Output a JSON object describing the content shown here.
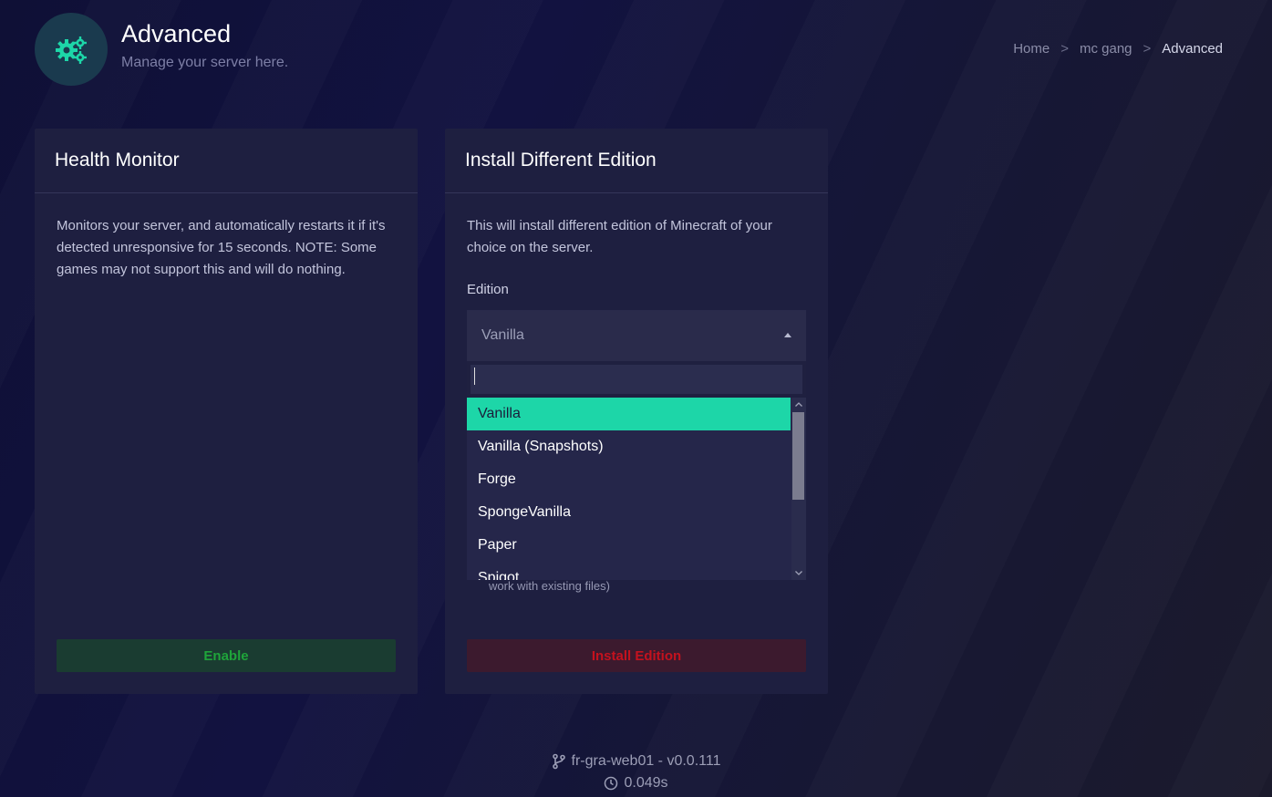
{
  "header": {
    "icon": "gears-icon",
    "title": "Advanced",
    "subtitle": "Manage your server here."
  },
  "breadcrumb": {
    "items": [
      "Home",
      "mc gang",
      "Advanced"
    ],
    "separator": ">"
  },
  "health_monitor": {
    "title": "Health Monitor",
    "description": "Monitors your server, and automatically restarts it if it's detected unresponsive for 15 seconds. NOTE: Some games may not support this and will do nothing.",
    "button_label": "Enable"
  },
  "install_edition": {
    "title": "Install Different Edition",
    "description": "This will install different edition of Minecraft of your choice on the server.",
    "field_label": "Edition",
    "selected_value": "Vanilla",
    "search_value": "",
    "options": [
      "Vanilla",
      "Vanilla (Snapshots)",
      "Forge",
      "SpongeVanilla",
      "Paper",
      "Spigot"
    ],
    "hint": "work with existing files)",
    "button_label": "Install Edition"
  },
  "footer": {
    "node": "fr-gra-web01 - v0.0.111",
    "time": "0.049s",
    "node_icon": "git-branch-icon",
    "time_icon": "clock-icon"
  },
  "colors": {
    "accent": "#1dd6a8",
    "enable_button_bg": "#1a3c31",
    "enable_text": "#1fa43a",
    "install_button_bg": "#3c1a2e",
    "install_text": "#c4121e",
    "card_bg": "#1e1f40"
  }
}
